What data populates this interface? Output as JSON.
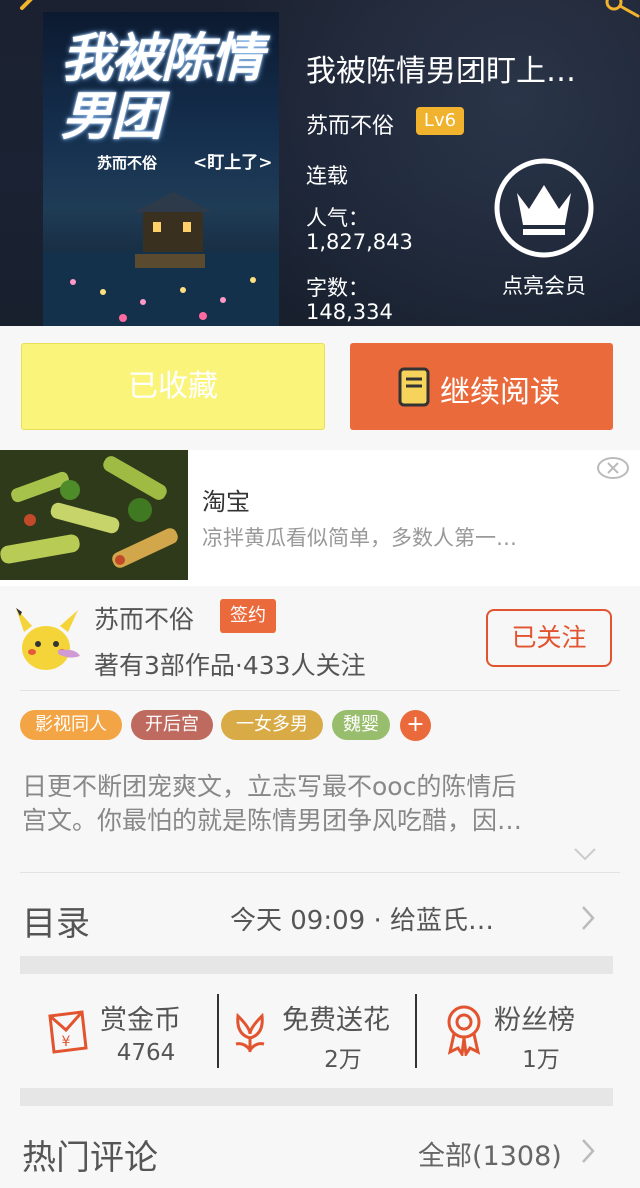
{
  "book": {
    "title": "我被陈情男团盯上…",
    "cover_title": "我被陈情男团",
    "cover_author": "苏而不俗",
    "cover_subtitle": "<盯上了>",
    "author": "苏而不俗",
    "level": "Lv6",
    "status": "连载",
    "popularity_label": "人气：",
    "popularity_value": "1,827,843",
    "wordcount_label": "字数：",
    "wordcount_value": "148,334"
  },
  "vip": {
    "label": "点亮会员",
    "icon": "crown-icon"
  },
  "actions": {
    "favorited_label": "已收藏",
    "continue_label": "继续阅读"
  },
  "ad": {
    "title": "淘宝",
    "description": "凉拌黄瓜看似简单，多数人第一…"
  },
  "author_section": {
    "name": "苏而不俗",
    "badge": "签约",
    "stats": "著有3部作品·433人关注",
    "follow_label": "已关注"
  },
  "tags": [
    {
      "label": "影视同人",
      "color": "#f3a445"
    },
    {
      "label": "开后宫",
      "color": "#bf6a5e"
    },
    {
      "label": "一女多男",
      "color": "#d8ab46"
    },
    {
      "label": "魏婴",
      "color": "#98be6d"
    }
  ],
  "tag_more": "+",
  "intro": {
    "line1": "日更不断团宠爽文，立志写最不ooc的陈情后",
    "line2": "宫文。你最怕的就是陈情男团争风吃醋，因…"
  },
  "toc": {
    "title": "目录",
    "latest": "今天 09:09 · 给蓝氏…"
  },
  "stats": {
    "reward_label": "赏金币",
    "reward_value": "4764",
    "flower_label": "免费送花",
    "flower_value": "2万",
    "fans_label": "粉丝榜",
    "fans_value": "1万"
  },
  "comments": {
    "title": "热门评论",
    "all_label": "全部(1308)"
  },
  "colors": {
    "accent": "#ea6a3b",
    "favorited_bg": "#fbf47a",
    "level_badge": "#f1b32d",
    "header_bg": "#1b2130"
  }
}
